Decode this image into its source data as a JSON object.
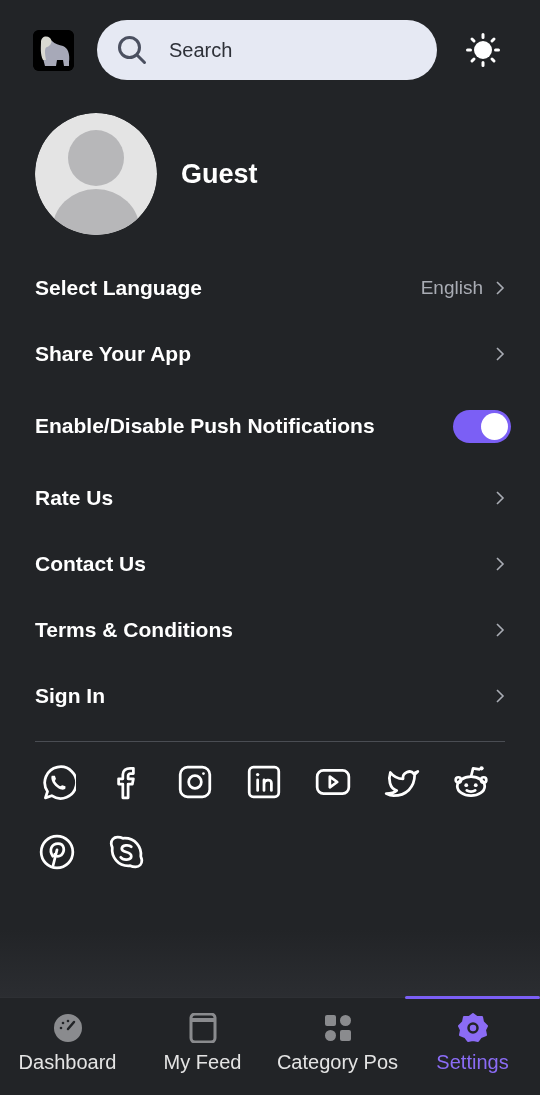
{
  "header": {
    "search": {
      "placeholder": "Search"
    }
  },
  "profile": {
    "name": "Guest"
  },
  "settings": [
    {
      "kind": "link",
      "label": "Select Language",
      "value": "English"
    },
    {
      "kind": "link",
      "label": "Share Your App"
    },
    {
      "kind": "toggle",
      "label": "Enable/Disable Push Notifications",
      "on": true
    },
    {
      "kind": "link",
      "label": "Rate Us"
    },
    {
      "kind": "link",
      "label": "Contact Us"
    },
    {
      "kind": "link",
      "label": "Terms & Conditions"
    },
    {
      "kind": "link",
      "label": "Sign In"
    }
  ],
  "bottom_nav": [
    {
      "label": "Dashboard",
      "selected": false
    },
    {
      "label": "My Feed",
      "selected": false
    },
    {
      "label": "Category Pos",
      "selected": false
    },
    {
      "label": "Settings",
      "selected": true
    }
  ]
}
